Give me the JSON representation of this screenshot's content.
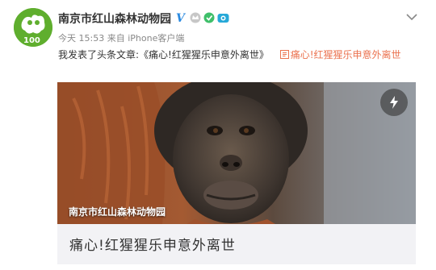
{
  "account": {
    "name": "南京市红山森林动物园",
    "verified_icon": "verified-v-icon",
    "badges": [
      "crown-badge-icon",
      "green-badge-icon",
      "camera-badge-icon"
    ]
  },
  "post": {
    "time": "今天 15:53",
    "source_prefix": "来自",
    "source_device": "iPhone客户端",
    "text_prefix": "我发表了头条文章:《痛心!红猩猩乐申意外离世》",
    "link_icon": "article-icon",
    "link_text": "痛心!红猩猩乐申意外离世"
  },
  "card": {
    "image_caption": "南京市红山森林动物园",
    "title": "痛心!红猩猩乐申意外离世",
    "flash_icon": "lightning-icon"
  },
  "colors": {
    "link": "#eb7350",
    "verified": "#2a8ae0",
    "avatar_green": "#5fae2e"
  }
}
